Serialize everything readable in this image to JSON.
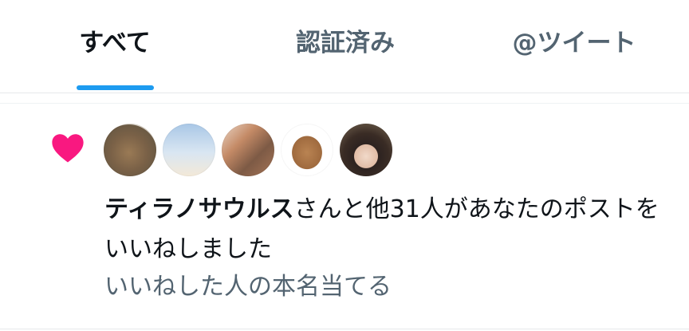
{
  "tabs": [
    {
      "label": "すべて",
      "active": true
    },
    {
      "label": "認証済み",
      "active": false
    },
    {
      "label": "@ツイート",
      "active": false
    }
  ],
  "colors": {
    "accent": "#1d9bf0",
    "heart": "#f91880",
    "text_primary": "#0f1419",
    "text_secondary": "#536471"
  },
  "notification": {
    "icon": "heart-icon",
    "avatars": [
      "avatar-dinosaur",
      "avatar-sky",
      "avatar-photo",
      "avatar-bird-plush",
      "avatar-person"
    ],
    "name": "ティラノサウルス",
    "message_rest": "さんと他31人があなたのポストをいいねしました",
    "subtext": "いいねした人の本名当てる"
  }
}
